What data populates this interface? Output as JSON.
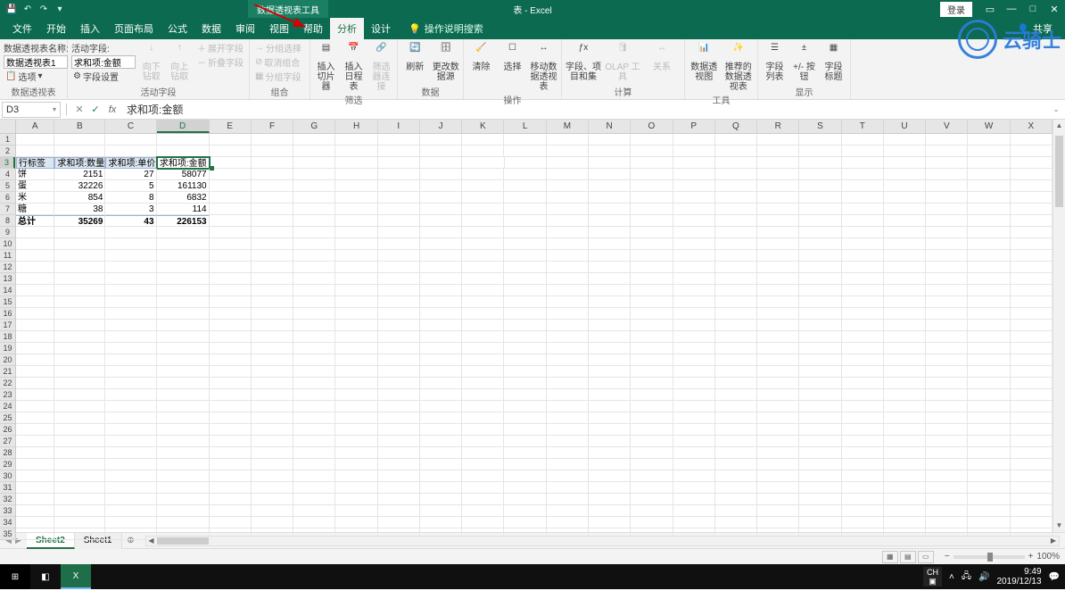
{
  "titlebar": {
    "contextual_tools": "数据透视表工具",
    "doc_title": "表 - Excel",
    "login": "登录"
  },
  "tabs": {
    "file": "文件",
    "home": "开始",
    "insert": "插入",
    "layout": "页面布局",
    "formulas": "公式",
    "data": "数据",
    "review": "审阅",
    "view": "视图",
    "help": "帮助",
    "analyze": "分析",
    "design": "设计",
    "tellme": "操作说明搜索",
    "share": "共享"
  },
  "ribbon": {
    "pt_name_lbl": "数据透视表名称:",
    "pt_name_val": "数据透视表1",
    "options": "选项",
    "grp_pivot": "数据透视表",
    "active_field_lbl": "活动字段:",
    "active_field_val": "求和项:金额",
    "field_settings": "字段设置",
    "drilldown": "向下钻取",
    "drillup": "向上钻取",
    "expand": "展开字段",
    "collapse": "折叠字段",
    "grp_active": "活动字段",
    "grp_sel": "分组选择",
    "ungroup": "取消组合",
    "grp_field": "分组字段",
    "grp_group": "组合",
    "slicer": "插入切片器",
    "timeline": "插入日程表",
    "filter_conn": "筛选器连接",
    "grp_filter": "筛选",
    "refresh": "刷新",
    "changesrc": "更改数据源",
    "grp_data": "数据",
    "clear": "清除",
    "select": "选择",
    "move": "移动数据透视表",
    "grp_actions": "操作",
    "calc_fields": "字段、项目和集",
    "olap": "OLAP 工具",
    "relations": "关系",
    "grp_calc": "计算",
    "chart": "数据透视图",
    "recommend": "推荐的数据透视表",
    "grp_tools": "工具",
    "fieldlist": "字段列表",
    "buttons": "+/- 按钮",
    "headers": "字段标题",
    "grp_show": "显示"
  },
  "fbar": {
    "name": "D3",
    "formula": "求和项:金额"
  },
  "columns": [
    "A",
    "B",
    "C",
    "D",
    "E",
    "F",
    "G",
    "H",
    "I",
    "J",
    "K",
    "L",
    "M",
    "N",
    "O",
    "P",
    "Q",
    "R",
    "S",
    "T",
    "U",
    "V",
    "W",
    "X"
  ],
  "col_widths": {
    "A": 44,
    "B": 58,
    "C": 58,
    "D": 60
  },
  "pivot": {
    "row_label": "行标签",
    "h_qty": "求和项:数量",
    "h_price": "求和项:单价",
    "h_amount": "求和项:金额",
    "rows": [
      {
        "label": "饼",
        "qty": 2151,
        "price": 27,
        "amount": 58077
      },
      {
        "label": "蛋",
        "qty": 32226,
        "price": 5,
        "amount": 161130
      },
      {
        "label": "米",
        "qty": 854,
        "price": 8,
        "amount": 6832
      },
      {
        "label": "糖",
        "qty": 38,
        "price": 3,
        "amount": 114
      }
    ],
    "total_label": "总计",
    "total": {
      "qty": 35269,
      "price": 43,
      "amount": 226153
    }
  },
  "sheets": {
    "s1": "Sheet2",
    "s2": "Sheet1"
  },
  "status": {
    "zoom": "100%"
  },
  "taskbar": {
    "ime": "CH",
    "time": "9:49",
    "date": "2019/12/13"
  },
  "watermark": "云骑士"
}
